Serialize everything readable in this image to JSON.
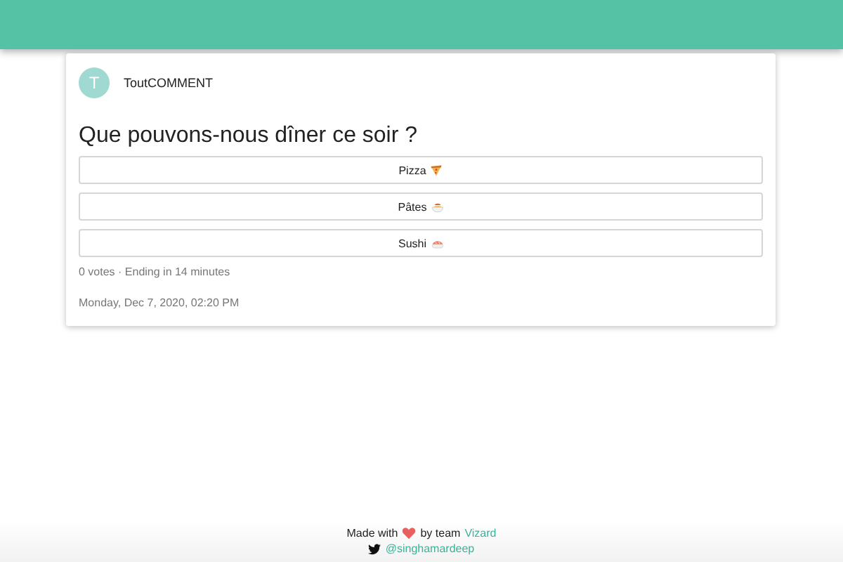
{
  "post": {
    "avatar_letter": "T",
    "author": "ToutCOMMENT",
    "question": "Que pouvons-nous dîner ce soir ?",
    "options": [
      {
        "label": "Pizza",
        "kind": "pizza"
      },
      {
        "label": "Pâtes",
        "kind": "pasta"
      },
      {
        "label": "Sushi",
        "kind": "sushi"
      }
    ],
    "meta": "0 votes · Ending in 14 minutes",
    "date": "Monday, Dec 7, 2020, 02:20 PM"
  },
  "footer": {
    "made_with": "Made with",
    "by_team": "by team",
    "team": "Vizard",
    "handle": "@singhamardeep"
  }
}
